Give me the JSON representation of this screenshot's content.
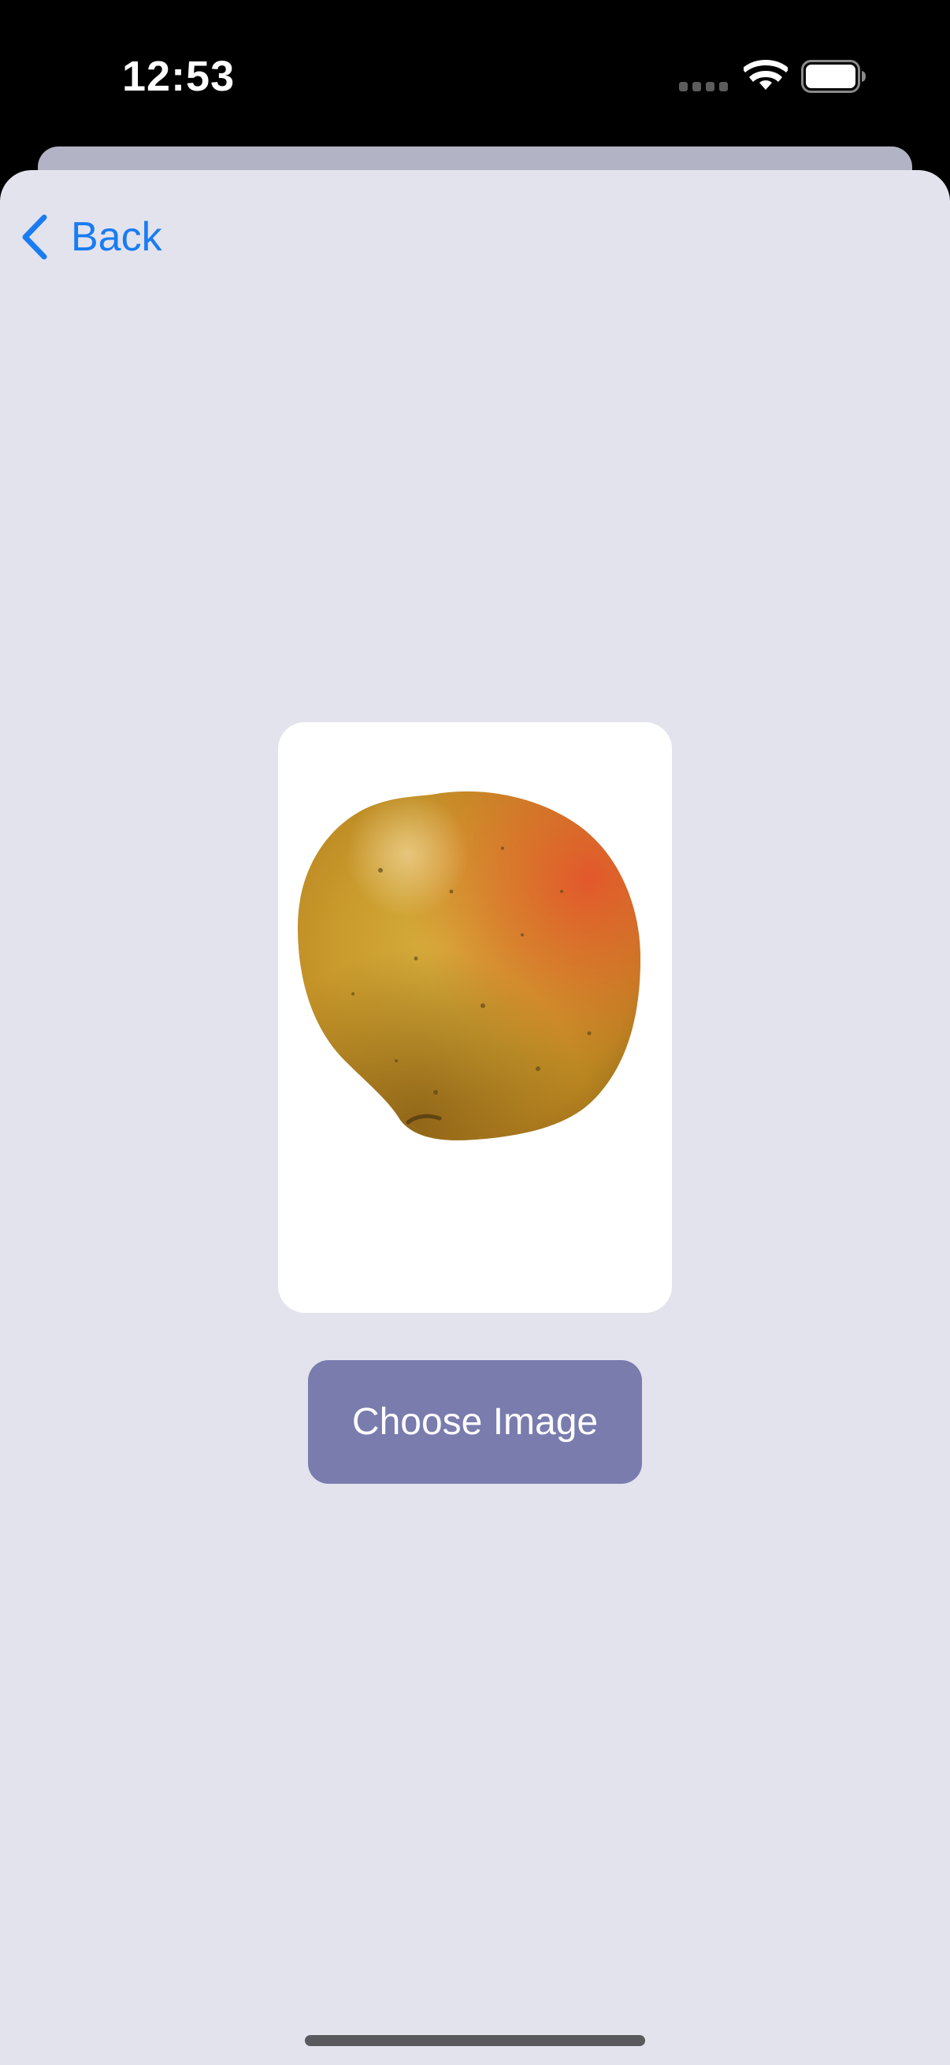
{
  "status_bar": {
    "time": "12:53",
    "icons": [
      "cellular-dots-icon",
      "wifi-icon",
      "battery-icon"
    ]
  },
  "navigation": {
    "back_label": "Back",
    "back_icon": "chevron-left-icon"
  },
  "main": {
    "selected_image": "mango-photo",
    "choose_button_label": "Choose Image"
  },
  "colors": {
    "accent": "#1a7cf2",
    "sheet_background": "#e3e3ee",
    "button_background": "#797cad",
    "button_text": "#ffffff"
  }
}
